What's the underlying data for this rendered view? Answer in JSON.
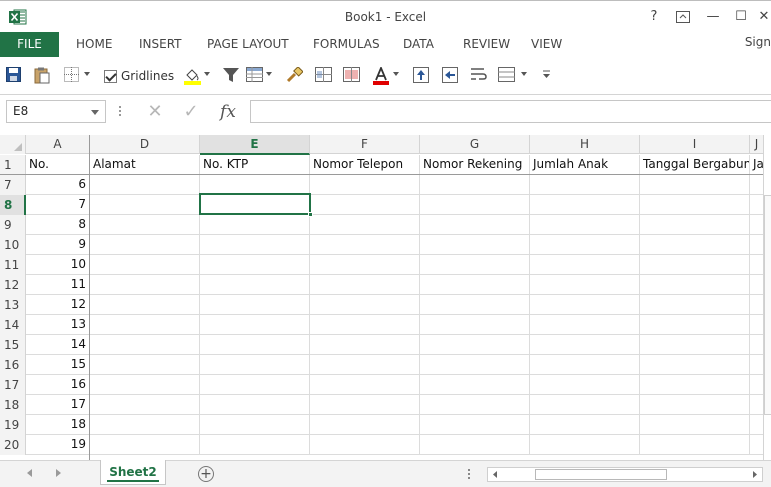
{
  "window": {
    "title": "Book1 - Excel",
    "help_label": "?",
    "minimize_label": "—",
    "maximize_label": "☐",
    "close_label": "✕"
  },
  "ribbon": {
    "tabs": [
      {
        "label": "FILE"
      },
      {
        "label": "HOME"
      },
      {
        "label": "INSERT"
      },
      {
        "label": "PAGE LAYOUT"
      },
      {
        "label": "FORMULAS"
      },
      {
        "label": "DATA"
      },
      {
        "label": "REVIEW"
      },
      {
        "label": "VIEW"
      }
    ],
    "signin_label": "Sign"
  },
  "toolbar": {
    "gridlines_label": "Gridlines",
    "gridlines_checked": true,
    "font_color": "#e00000",
    "fill_color": "#ffff00"
  },
  "formula_bar": {
    "name_box": "E8",
    "fx_label": "fx",
    "cancel_icon": "✕",
    "enter_icon": "✓",
    "formula": ""
  },
  "sheet": {
    "columns": [
      {
        "label": "A"
      },
      {
        "label": "D"
      },
      {
        "label": "E"
      },
      {
        "label": "F"
      },
      {
        "label": "G"
      },
      {
        "label": "H"
      },
      {
        "label": "I"
      },
      {
        "label": "J"
      }
    ],
    "selected_column": "E",
    "selected_row": "8",
    "header_row": {
      "row_number": "1",
      "cells": [
        "No.",
        "Alamat",
        "No. KTP",
        "Nomor Telepon",
        "Nomor Rekening",
        "Jumlah Anak",
        "Tanggal Bergabung",
        "Ja"
      ]
    },
    "rows": [
      {
        "row_number": "7",
        "a": "6"
      },
      {
        "row_number": "8",
        "a": "7"
      },
      {
        "row_number": "9",
        "a": "8"
      },
      {
        "row_number": "10",
        "a": "9"
      },
      {
        "row_number": "11",
        "a": "10"
      },
      {
        "row_number": "12",
        "a": "11"
      },
      {
        "row_number": "13",
        "a": "12"
      },
      {
        "row_number": "14",
        "a": "13"
      },
      {
        "row_number": "15",
        "a": "14"
      },
      {
        "row_number": "16",
        "a": "15"
      },
      {
        "row_number": "17",
        "a": "16"
      },
      {
        "row_number": "18",
        "a": "17"
      },
      {
        "row_number": "19",
        "a": "18"
      },
      {
        "row_number": "20",
        "a": "19"
      }
    ]
  },
  "sheet_tabs": {
    "tabs": [
      {
        "label": "Sheet2"
      }
    ],
    "add_label": "+"
  },
  "colors": {
    "accent": "#217346"
  }
}
